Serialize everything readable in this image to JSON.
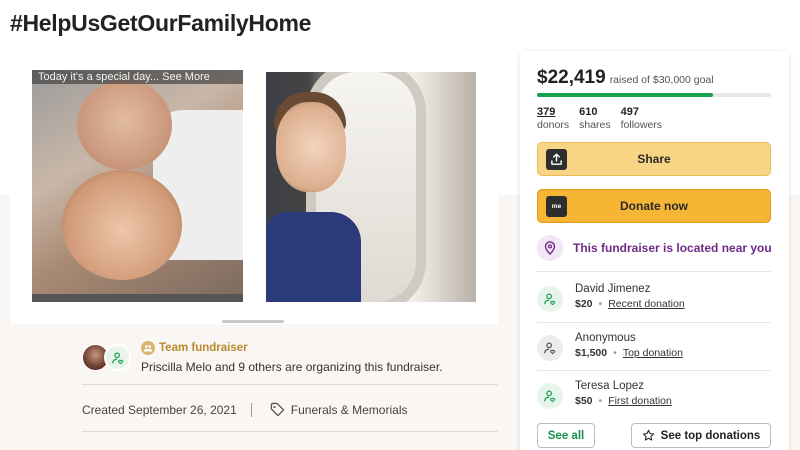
{
  "page": {
    "title": "#HelpUsGetOurFamilyHome"
  },
  "media": {
    "photo_caption": "Today it's a special day... See More",
    "scroll_indicator_position": 1
  },
  "organizer": {
    "team_label": "Team fundraiser",
    "summary": "Priscilla Melo and 9 others are organizing this fundraiser.",
    "created": "Created September 26, 2021",
    "category": "Funerals & Memorials"
  },
  "sidebar": {
    "raised": "$22,419",
    "goal_text": "raised of $30,000 goal",
    "progress_fraction": 0.75,
    "stats": [
      {
        "value": "379",
        "label": "donors"
      },
      {
        "value": "610",
        "label": "shares"
      },
      {
        "value": "497",
        "label": "followers"
      }
    ],
    "share_label": "Share",
    "donate_label": "Donate now",
    "donate_icon_text": "me",
    "location_text": "This fundraiser is located near you",
    "donations": [
      {
        "name": "David Jimenez",
        "amount": "$20",
        "kind": "Recent donation"
      },
      {
        "name": "Anonymous",
        "amount": "$1,500",
        "kind": "Top donation"
      },
      {
        "name": "Teresa Lopez",
        "amount": "$50",
        "kind": "First donation"
      }
    ],
    "see_all_label": "See all",
    "see_top_label": "See top donations"
  },
  "colors": {
    "accent_green": "#17a14d",
    "share_button": "#f8d584",
    "donate_button": "#f7b536",
    "location_purple": "#6d2b86",
    "team_gold": "#b98a2c"
  }
}
